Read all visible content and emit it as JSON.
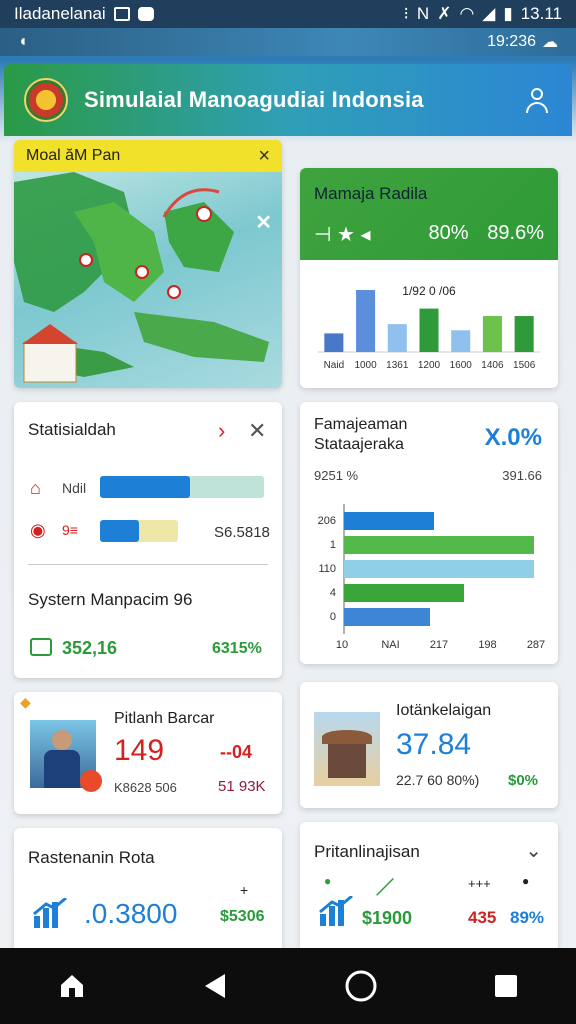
{
  "status_bar": {
    "carrier": "Iladanelanai",
    "time": "13.11",
    "network_label": "N"
  },
  "sub_bar": {
    "time": "19:236"
  },
  "header": {
    "title": "Simulaial Manoagudiai Indonsia"
  },
  "map_card": {
    "title": "Moal ăM Pan",
    "close": "×"
  },
  "stat_card": {
    "title": "Mamaja Radila",
    "icons": "⊣ ★ ◂",
    "value1": "80%",
    "value2": "89.6%",
    "chart_label": "1/92 0 /06",
    "chart_data": {
      "type": "bar",
      "categories": [
        "Naid",
        "1000",
        "1361",
        "1200",
        "1600",
        "1406",
        "1506"
      ],
      "values": [
        30,
        100,
        45,
        70,
        35,
        58,
        58
      ],
      "colors": [
        "#4a78c8",
        "#5b8fdc",
        "#8fc0ee",
        "#2e9a3a",
        "#8fc0ee",
        "#6cc24a",
        "#2e9a3a"
      ]
    }
  },
  "statistik_card": {
    "title": "Statisialdah",
    "row1_label": "Ndil",
    "row2_label": "9≡",
    "row2_value": "S6.5818",
    "row1_fill": 0.55,
    "row2_fill": 0.5,
    "section_title": "Systern Manpacim 96",
    "footer_value1": "352,16",
    "footer_value2": "6315%"
  },
  "hchart_card": {
    "title_line1": "Famajeaman",
    "title_line2": "Stataajeraka",
    "percent": "X.0%",
    "sub_left": "9251 %",
    "sub_right": "391.66",
    "chart_data": {
      "type": "bar",
      "orientation": "horizontal",
      "categories": [
        "206",
        "1",
        "110",
        "4",
        "0"
      ],
      "series": [
        {
          "values": [
            0.45,
            0.95,
            0.95,
            0.6,
            0.43
          ],
          "colors": [
            "#1e7fd6",
            "#52b84a",
            "#8fd0e6",
            "#3aa63a",
            "#3d86d6"
          ]
        }
      ],
      "x_ticks": [
        "10",
        "NAI",
        "217",
        "198",
        "287"
      ]
    }
  },
  "person_card": {
    "title": "Pitlanh Barcar",
    "value": "149",
    "change": "--04",
    "sub_left": "K8628 506",
    "sub_right": "51 93K"
  },
  "temple_card": {
    "title": "Iotänkelaigan",
    "value": "37.84",
    "sub_left": "22.7 60 80%)",
    "sub_right": "$0%"
  },
  "bottom_left": {
    "title": "Rastenanin Rota",
    "value": ".0.3800",
    "right_value": "$5306",
    "plus": "+"
  },
  "bottom_right": {
    "title": "Pritanlinajisan",
    "value1": "$1900",
    "value2": "435",
    "value3": "89%",
    "tick": "+++"
  },
  "colors": {
    "accent_green": "#2a9a3a",
    "accent_blue": "#1e7fd6",
    "accent_red": "#d32020",
    "header_start": "#2a9a45",
    "header_end": "#2c86d4"
  }
}
